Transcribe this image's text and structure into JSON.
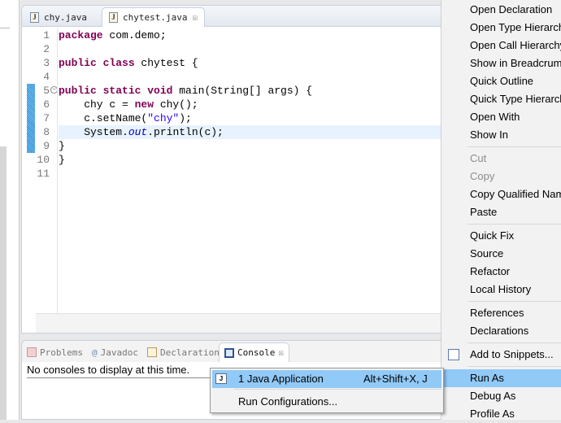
{
  "editor": {
    "tabs": [
      {
        "label": "chy.java",
        "active": false
      },
      {
        "label": "chytest.java",
        "active": true
      }
    ],
    "lines": [
      {
        "n": "1"
      },
      {
        "n": "2"
      },
      {
        "n": "3"
      },
      {
        "n": "4"
      },
      {
        "n": "5"
      },
      {
        "n": "6"
      },
      {
        "n": "7"
      },
      {
        "n": "8"
      },
      {
        "n": "9"
      },
      {
        "n": "10"
      },
      {
        "n": "11"
      }
    ],
    "code": {
      "l1_kw": "package",
      "l1_rest": " com.demo;",
      "l3_kw": "public class",
      "l3_rest": " chytest {",
      "l5_kw": "public static void",
      "l5_rest": " main(String[] args) {",
      "l6_a": "    chy c = ",
      "l6_kw": "new",
      "l6_b": " chy();",
      "l7_a": "    c.setName(",
      "l7_str": "\"chy\"",
      "l7_b": ");",
      "l8_a": "    System.",
      "l8_fld": "out",
      "l8_b": ".println(c);",
      "l9": "}",
      "l10": "}"
    }
  },
  "bottom_panel": {
    "tabs": [
      "Problems",
      "Javadoc",
      "Declaration",
      "Console"
    ],
    "active_tab": "Console",
    "message": "No consoles to display at this time."
  },
  "context_menu": {
    "groups": [
      [
        "Open Declaration",
        "Open Type Hierarchy",
        "Open Call Hierarchy",
        "Show in Breadcrumb",
        "Quick Outline",
        "Quick Type Hierarchy",
        "Open With",
        "Show In"
      ],
      [
        "Cut",
        "Copy",
        "Copy Qualified Name",
        "Paste"
      ],
      [
        "Quick Fix",
        "Source",
        "Refactor",
        "Local History"
      ],
      [
        "References",
        "Declarations"
      ],
      [
        "Add to Snippets..."
      ],
      [
        "Run As",
        "Debug As",
        "Profile As"
      ]
    ],
    "disabled": [
      "Cut",
      "Copy"
    ],
    "highlighted": "Run As"
  },
  "run_as_submenu": {
    "items": [
      {
        "label": "1 Java Application",
        "shortcut": "Alt+Shift+X, J"
      },
      {
        "label": "Run Configurations..."
      }
    ]
  },
  "colors": {
    "highlight": "#91c9f7",
    "keyword": "#7f0055",
    "string": "#2a00ff"
  }
}
